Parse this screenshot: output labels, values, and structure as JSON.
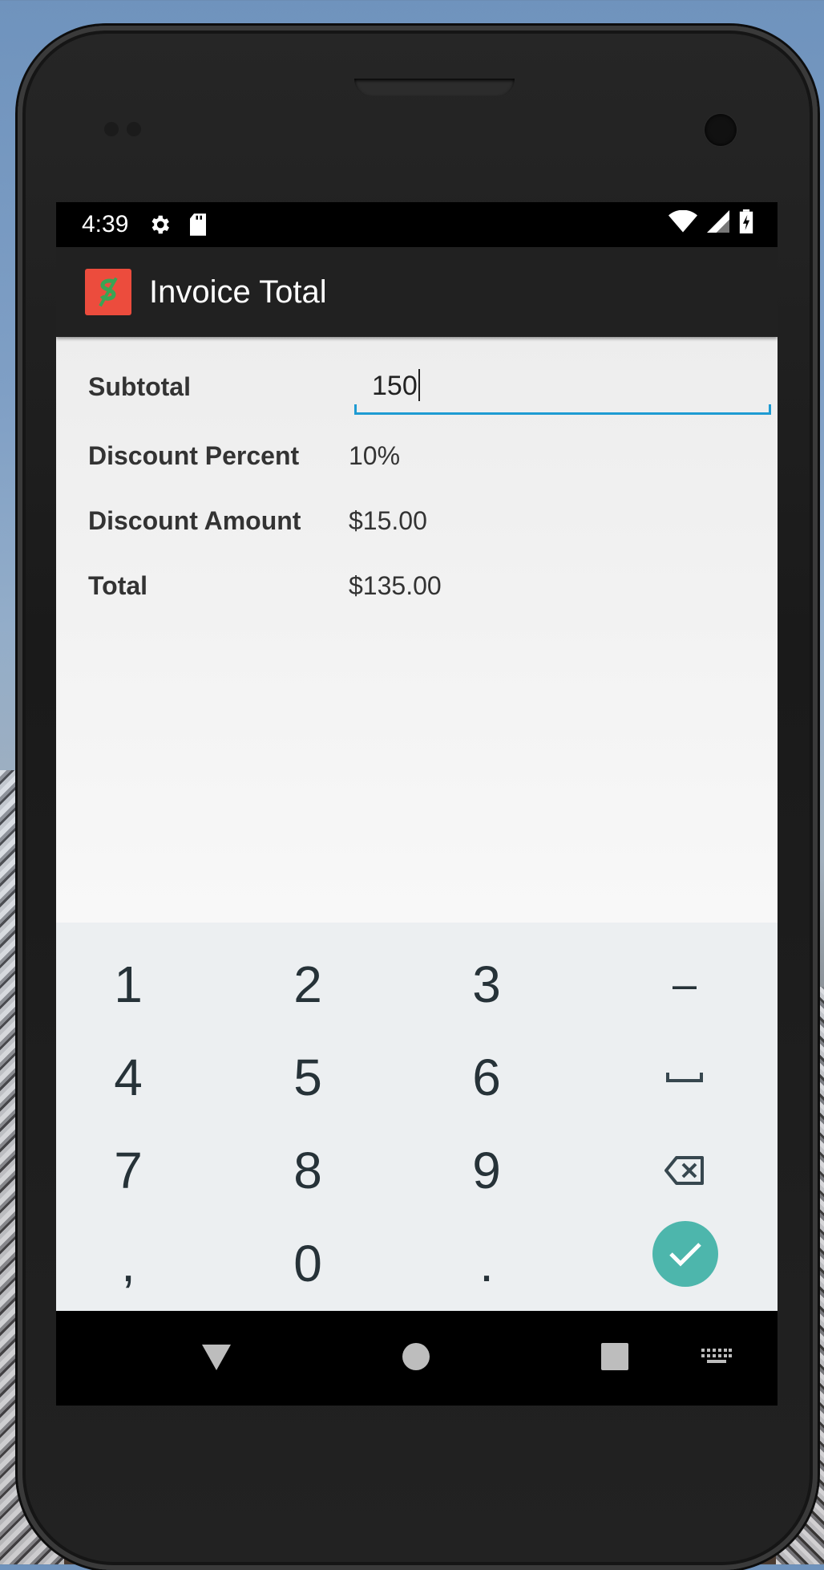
{
  "status_bar": {
    "time": "4:39",
    "left_icons": [
      "gear-icon",
      "sd-card-icon"
    ],
    "right_icons": [
      "wifi-icon",
      "signal-icon",
      "battery-charging-icon"
    ]
  },
  "app_bar": {
    "title": "Invoice Total",
    "icon": "dollar-sign-icon",
    "icon_bg": "#ec4c3d"
  },
  "form": {
    "subtotal": {
      "label": "Subtotal",
      "value": "150"
    },
    "discount_percent": {
      "label": "Discount Percent",
      "value": "10%"
    },
    "discount_amount": {
      "label": "Discount Amount",
      "value": "$15.00"
    },
    "total": {
      "label": "Total",
      "value": "$135.00"
    },
    "accent_color": "#1e9bd2"
  },
  "keyboard": {
    "keys": [
      "1",
      "2",
      "3",
      "–",
      "4",
      "5",
      "6",
      "␣",
      "7",
      "8",
      "9",
      "⌫",
      ",",
      "0",
      ".",
      "✓"
    ],
    "enter_color": "#4db6ac"
  },
  "nav_bar": {
    "buttons": [
      "back-icon",
      "home-icon",
      "recents-icon",
      "keyboard-icon"
    ]
  }
}
